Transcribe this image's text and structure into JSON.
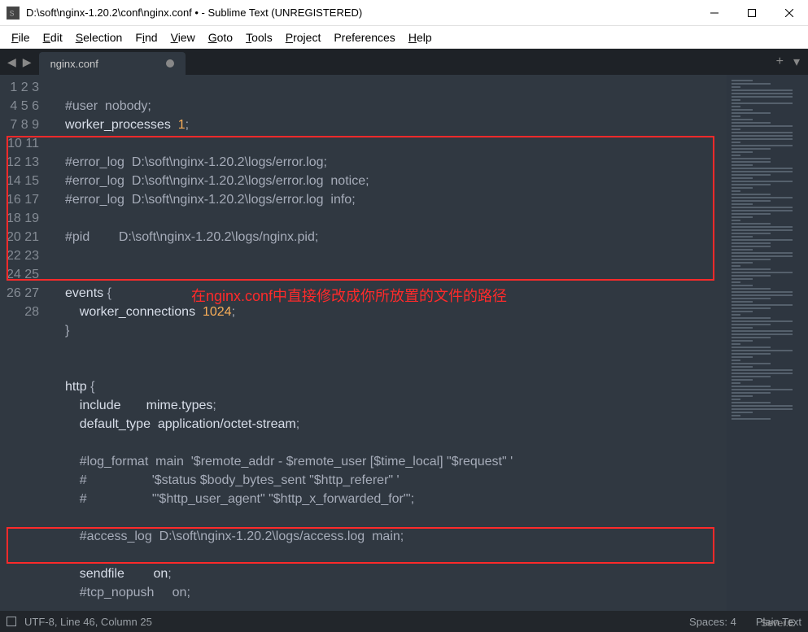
{
  "window": {
    "title": "D:\\soft\\nginx-1.20.2\\conf\\nginx.conf • - Sublime Text (UNREGISTERED)"
  },
  "menu": {
    "file": "File",
    "edit": "Edit",
    "selection": "Selection",
    "find": "Find",
    "view": "View",
    "goto": "Goto",
    "tools": "Tools",
    "project": "Project",
    "preferences": "Preferences",
    "help": "Help"
  },
  "tab": {
    "label": "nginx.conf"
  },
  "code": {
    "lines": [
      "",
      "#user  nobody;",
      "worker_processes  1;",
      "",
      "#error_log  D:\\soft\\nginx-1.20.2\\logs/error.log;",
      "#error_log  D:\\soft\\nginx-1.20.2\\logs/error.log  notice;",
      "#error_log  D:\\soft\\nginx-1.20.2\\logs/error.log  info;",
      "",
      "#pid        D:\\soft\\nginx-1.20.2\\logs/nginx.pid;",
      "",
      "",
      "events {",
      "    worker_connections  1024;",
      "}",
      "",
      "",
      "http {",
      "    include       mime.types;",
      "    default_type  application/octet-stream;",
      "",
      "    #log_format  main  '$remote_addr - $remote_user [$time_local] \"$request\" '",
      "    #                  '$status $body_bytes_sent \"$http_referer\" '",
      "    #                  '\"$http_user_agent\" \"$http_x_forwarded_for\"';",
      "",
      "    #access_log  D:\\soft\\nginx-1.20.2\\logs/access.log  main;",
      "",
      "    sendfile        on;",
      "    #tcp_nopush     on;"
    ],
    "first_line_no": 1
  },
  "annotation": {
    "text": "在nginx.conf中直接修改成你所放置的文件的路径"
  },
  "statusbar": {
    "encoding_pos": "UTF-8, Line 46, Column 25",
    "spaces": "Spaces: 4",
    "syntax": "Plain Text"
  },
  "watermark": "Sever.E"
}
